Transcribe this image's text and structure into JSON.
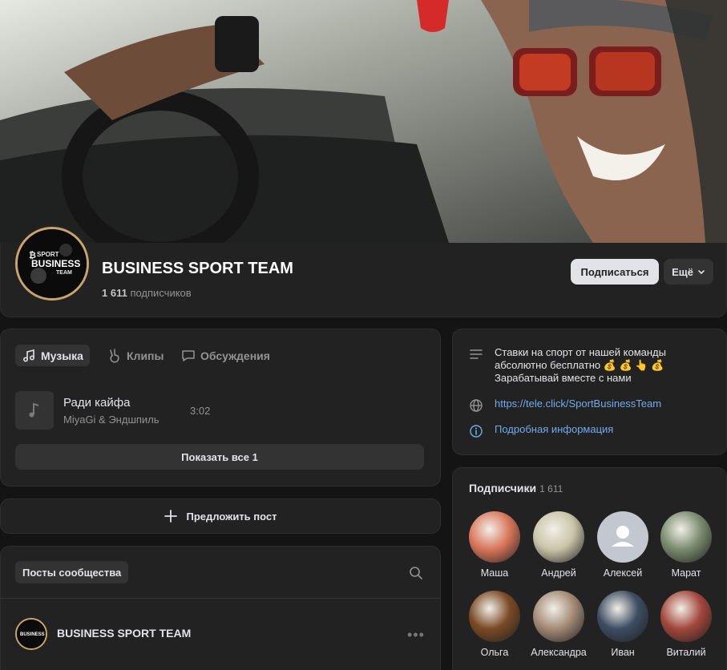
{
  "group": {
    "name": "BUSINESS SPORT TEAM",
    "subscribers_count": "1 611",
    "subscribers_word": "подписчиков",
    "subscribe_label": "Подписаться",
    "more_label": "Ещё",
    "logo_text": [
      "SPORT",
      "BUSINESS",
      "TEAM"
    ]
  },
  "tabs": [
    {
      "label": "Музыка",
      "icon": "music-note-icon",
      "active": true
    },
    {
      "label": "Клипы",
      "icon": "clips-hand-icon",
      "active": false
    },
    {
      "label": "Обсуждения",
      "icon": "chat-bubble-icon",
      "active": false
    }
  ],
  "track": {
    "title": "Ради кайфа",
    "artist": "MiyaGi & Эндшпиль",
    "duration": "3:02"
  },
  "show_all_label": "Показать все 1",
  "suggest_post_label": "Предложить пост",
  "posts": {
    "label": "Посты сообщества",
    "author": "BUSINESS SPORT TEAM"
  },
  "info": {
    "description": [
      "Ставки на спорт от нашей команды",
      "абсолютно бесплатно 💰 💰 👆 💰",
      "Зарабатывай вместе с нами"
    ],
    "link": "https://tele.click/SportBusinessTeam",
    "details_label": "Подробная информация"
  },
  "subscribers": {
    "title": "Подписчики",
    "count": "1 611",
    "members": [
      {
        "name": "Маша",
        "color": "#d9765a"
      },
      {
        "name": "Андрей",
        "color": "#c9c4a8"
      },
      {
        "name": "Алексей",
        "color": "#c3c7cf"
      },
      {
        "name": "Марат",
        "color": "#7a8b6e"
      },
      {
        "name": "Ольга",
        "color": "#7a4a26"
      },
      {
        "name": "Александра",
        "color": "#a48a76"
      },
      {
        "name": "Иван",
        "color": "#3e4d63"
      },
      {
        "name": "Виталий",
        "color": "#a3473c"
      }
    ]
  },
  "colors": {
    "accent_link": "#71aaeb",
    "background": "#141414",
    "card": "#222222",
    "logo_ring": "#c9a56b"
  }
}
